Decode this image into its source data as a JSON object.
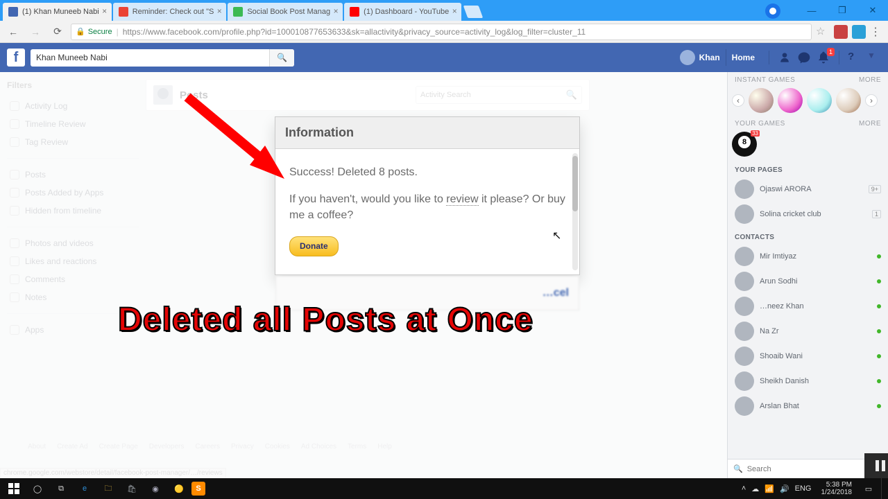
{
  "browser": {
    "tabs": [
      {
        "title": "(1) Khan Muneeb Nabi",
        "favicon": "#4267b2",
        "active": true
      },
      {
        "title": "Reminder: Check out \"S",
        "favicon": "#ea4335",
        "active": false
      },
      {
        "title": "Social Book Post Manag",
        "favicon": "#3cba54",
        "active": false
      },
      {
        "title": "(1) Dashboard - YouTube",
        "favicon": "#ff0000",
        "active": false
      }
    ],
    "secure_label": "Secure",
    "url": "https://www.facebook.com/profile.php?id=100010877653633&sk=allactivity&privacy_source=activity_log&log_filter=cluster_11"
  },
  "fb": {
    "search_value": "Khan Muneeb Nabi",
    "user_name": "Khan",
    "home_label": "Home",
    "notif_badge": "1"
  },
  "sidebar": {
    "heading": "Filters",
    "groups": [
      [
        "Activity Log",
        "Timeline Review",
        "Tag Review"
      ],
      [
        "Posts",
        "Posts Added by Apps",
        "Hidden from timeline"
      ],
      [
        "Photos and videos",
        "Likes and reactions",
        "Comments",
        "Notes"
      ],
      [
        "Apps"
      ]
    ]
  },
  "posts_header": {
    "title": "Posts",
    "search_placeholder": "Activity Search"
  },
  "dialog": {
    "title": "Information",
    "line1": "Success! Deleted 8 posts.",
    "line2a": "If you haven't, would you like to ",
    "review": "review",
    "line2b": " it please? Or buy me a coffee?",
    "donate": "Donate",
    "footer_btn": "…cel"
  },
  "right": {
    "instant_h": "INSTANT GAMES",
    "more": "MORE",
    "your_games_h": "YOUR GAMES",
    "pool_badge": "33",
    "pages_h": "YOUR PAGES",
    "pages": [
      {
        "name": "Ojaswi ARORA",
        "badge": "9+"
      },
      {
        "name": "Solina cricket club",
        "badge": "1"
      }
    ],
    "contacts_h": "CONTACTS",
    "contacts": [
      "Mir Imtiyaz",
      "Arun Sodhi",
      "…neez Khan",
      "Na Zr",
      "Shoaib Wani",
      "Sheikh Danish",
      "Arslan Bhat"
    ],
    "search_placeholder": "Search"
  },
  "annotation": "Deleted all Posts at Once",
  "footer_links": [
    "About",
    "Create Ad",
    "Create Page",
    "Developers",
    "Careers",
    "Privacy",
    "Cookies",
    "Ad Choices",
    "Terms",
    "Help"
  ],
  "status_url": "chrome.google.com/webstore/detail/facebook-post-manager/…/reviews",
  "taskbar": {
    "time": "5:38 PM",
    "date": "1/24/2018"
  }
}
